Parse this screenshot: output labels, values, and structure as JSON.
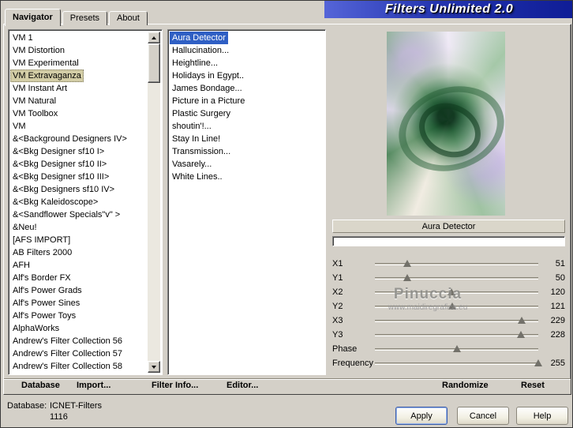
{
  "window": {
    "title": "Filters Unlimited 2.0"
  },
  "tabs": {
    "navigator": "Navigator",
    "presets": "Presets",
    "about": "About"
  },
  "category_list": {
    "selected": "VM Extravaganza",
    "items": [
      "VM 1",
      "VM Distortion",
      "VM Experimental",
      "VM Extravaganza",
      "VM Instant Art",
      "VM Natural",
      "VM Toolbox",
      "VM",
      "&<Background Designers IV>",
      "&<Bkg Designer sf10 I>",
      "&<Bkg Designer sf10 II>",
      "&<Bkg Designer sf10 III>",
      "&<Bkg Designers sf10 IV>",
      "&<Bkg Kaleidoscope>",
      "&<Sandflower Specials\"v\" >",
      "&Neu!",
      "[AFS IMPORT]",
      "AB Filters 2000",
      "AFH",
      "Alf's Border FX",
      "Alf's Power Grads",
      "Alf's Power Sines",
      "Alf's Power Toys",
      "AlphaWorks",
      "Andrew's Filter Collection 56",
      "Andrew's Filter Collection 57",
      "Andrew's Filter Collection 58"
    ]
  },
  "filter_list": {
    "selected": "Aura Detector",
    "items": [
      "Aura Detector",
      "Hallucination...",
      "Heightline...",
      "Holidays in Egypt..",
      "James Bondage...",
      "Picture in a Picture",
      "Plastic Surgery",
      "shoutin'!...",
      "Stay In Line!",
      "Transmission...",
      "Vasarely...",
      "White Lines.."
    ]
  },
  "preview": {
    "caption": "Aura Detector"
  },
  "watermark": {
    "title": "Pinuccia",
    "url": "www.maidiregrafica.eu"
  },
  "sliders": [
    {
      "label": "X1",
      "value": "51",
      "pos": 0.2
    },
    {
      "label": "Y1",
      "value": "50",
      "pos": 0.196
    },
    {
      "label": "X2",
      "value": "120",
      "pos": 0.47
    },
    {
      "label": "Y2",
      "value": "121",
      "pos": 0.475
    },
    {
      "label": "X3",
      "value": "229",
      "pos": 0.898
    },
    {
      "label": "Y3",
      "value": "228",
      "pos": 0.894
    },
    {
      "label": "Phase",
      "value": "",
      "pos": 0.5
    },
    {
      "label": "Frequency",
      "value": "255",
      "pos": 1.0
    }
  ],
  "toolbar": {
    "database": "Database",
    "import": "Import...",
    "filter_info": "Filter Info...",
    "editor": "Editor...",
    "randomize": "Randomize",
    "reset": "Reset"
  },
  "statusbar": {
    "label": "Database:",
    "value": "ICNET-Filters",
    "count": "1116"
  },
  "buttons": {
    "apply": "Apply",
    "cancel": "Cancel",
    "help": "Help"
  }
}
